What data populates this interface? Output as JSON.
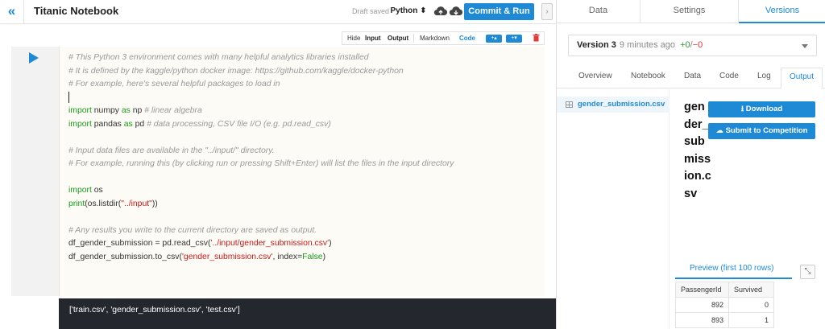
{
  "header": {
    "collapse_icon": "double-chevron-left",
    "title": "Titanic Notebook",
    "status": "Draft saved",
    "language": "Python",
    "language_caret": "⬍",
    "commit_label": "Commit & Run",
    "side_toggle": "›"
  },
  "cell_toolbar": {
    "hide": "Hide",
    "input": "Input",
    "output": "Output",
    "markdown": "Markdown",
    "code": "Code",
    "add_above": "+▴",
    "add_below": "+▾"
  },
  "code_lines": [
    [
      {
        "t": "# This Python 3 environment comes with many helpful analytics libraries installed",
        "c": "c"
      }
    ],
    [
      {
        "t": "# It is defined by the kaggle/python docker image: https://github.com/kaggle/docker-python",
        "c": "c"
      }
    ],
    [
      {
        "t": "# For example, here's several helpful packages to load in",
        "c": "c"
      }
    ],
    [
      {
        "cursor": true
      }
    ],
    [
      {
        "t": "import",
        "c": "k"
      },
      {
        "t": " numpy "
      },
      {
        "t": "as",
        "c": "k"
      },
      {
        "t": " np "
      },
      {
        "t": "# linear algebra",
        "c": "c"
      }
    ],
    [
      {
        "t": "import",
        "c": "k"
      },
      {
        "t": " pandas "
      },
      {
        "t": "as",
        "c": "k"
      },
      {
        "t": " pd "
      },
      {
        "t": "# data processing, CSV file I/O (e.g. pd.read_csv)",
        "c": "c"
      }
    ],
    [],
    [
      {
        "t": "# Input data files are available in the \"../input/\" directory.",
        "c": "c"
      }
    ],
    [
      {
        "t": "# For example, running this (by clicking run or pressing Shift+Enter) will list the files in the input directory",
        "c": "c"
      }
    ],
    [],
    [
      {
        "t": "import",
        "c": "k"
      },
      {
        "t": " os"
      }
    ],
    [
      {
        "t": "print",
        "c": "k"
      },
      {
        "t": "(os.listdir("
      },
      {
        "t": "\"../input\"",
        "c": "s"
      },
      {
        "t": "))"
      }
    ],
    [],
    [
      {
        "t": "# Any results you write to the current directory are saved as output.",
        "c": "c"
      }
    ],
    [
      {
        "t": "df_gender_submission = pd.read_csv("
      },
      {
        "t": "'../input/gender_submission.csv'",
        "c": "s"
      },
      {
        "t": ")"
      }
    ],
    [
      {
        "t": "df_gender_submission.to_csv("
      },
      {
        "t": "'gender_submission.csv'",
        "c": "s"
      },
      {
        "t": ", index="
      },
      {
        "t": "False",
        "c": "k"
      },
      {
        "t": ")"
      }
    ]
  ],
  "cell_output": "['train.csv', 'gender_submission.csv', 'test.csv']",
  "sidebar": {
    "tabs": [
      "Data",
      "Settings",
      "Versions"
    ],
    "active_tab": "Versions",
    "version": {
      "name": "Version 3",
      "time": "9 minutes ago",
      "added": "+0",
      "separator": "/",
      "removed": "−0"
    },
    "subtabs": [
      "Overview",
      "Notebook",
      "Data",
      "Code",
      "Log",
      "Output"
    ],
    "active_subtab": "Output",
    "file": "gender_submission.csv",
    "file_title": "gender_submission.csv",
    "download_label": "⭳ Download",
    "submit_label": "☁ Submit to Competition",
    "preview_label": "Preview (first 100 rows)",
    "expand_icon": "⤡",
    "table": {
      "columns": [
        "PassengerId",
        "Survived"
      ],
      "rows": [
        [
          "892",
          "0"
        ],
        [
          "893",
          "1"
        ]
      ]
    }
  },
  "colors": {
    "accent": "#1e8ad6",
    "output_bg": "#24272e",
    "code_bg": "#fcfbf6",
    "keyword": "#1a9a1a",
    "string": "#c41a16",
    "comment": "#999999"
  }
}
